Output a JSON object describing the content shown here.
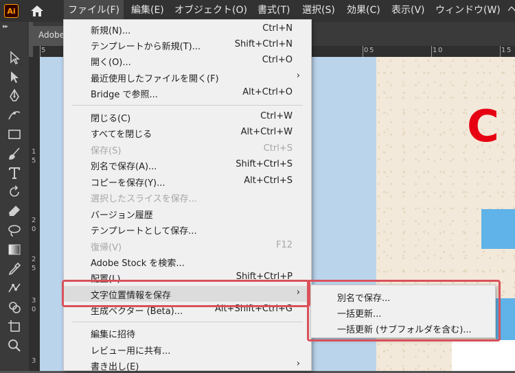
{
  "app": {
    "logo_text": "Ai",
    "document_tab": "Adobe"
  },
  "menubar": {
    "items": [
      {
        "label": "ファイル(F)"
      },
      {
        "label": "編集(E)"
      },
      {
        "label": "オブジェクト(O)"
      },
      {
        "label": "書式(T)"
      },
      {
        "label": "選択(S)"
      },
      {
        "label": "効果(C)"
      },
      {
        "label": "表示(V)"
      },
      {
        "label": "ウィンドウ(W)"
      }
    ],
    "overflow": "ヘ"
  },
  "rulers": {
    "top": [
      "5",
      "0",
      "5",
      "1",
      "0",
      "1",
      "5"
    ],
    "left": [
      "1",
      "5",
      "2",
      "0",
      "2",
      "5",
      "3",
      "0",
      "3"
    ]
  },
  "file_menu": {
    "items": [
      {
        "label": "新規(N)...",
        "shortcut": "Ctrl+N"
      },
      {
        "label": "テンプレートから新規(T)...",
        "shortcut": "Shift+Ctrl+N"
      },
      {
        "label": "開く(O)...",
        "shortcut": "Ctrl+O"
      },
      {
        "label": "最近使用したファイルを開く(F)",
        "shortcut": "",
        "submenu": true
      },
      {
        "label": "Bridge で参照...",
        "shortcut": "Alt+Ctrl+O"
      },
      {
        "label": "閉じる(C)",
        "shortcut": "Ctrl+W"
      },
      {
        "label": "すべてを閉じる",
        "shortcut": "Alt+Ctrl+W"
      },
      {
        "label": "保存(S)",
        "shortcut": "Ctrl+S",
        "disabled": true
      },
      {
        "label": "別名で保存(A)...",
        "shortcut": "Shift+Ctrl+S"
      },
      {
        "label": "コピーを保存(Y)...",
        "shortcut": "Alt+Ctrl+S"
      },
      {
        "label": "選択したスライスを保存...",
        "shortcut": "",
        "disabled": true
      },
      {
        "label": "バージョン履歴",
        "shortcut": ""
      },
      {
        "label": "テンプレートとして保存...",
        "shortcut": ""
      },
      {
        "label": "復帰(V)",
        "shortcut": "F12",
        "disabled": true
      },
      {
        "label": "Adobe Stock を検索...",
        "shortcut": ""
      },
      {
        "label": "配置(L)...",
        "shortcut": "Shift+Ctrl+P"
      },
      {
        "label": "文字位置情報を保存",
        "shortcut": "",
        "submenu": true,
        "highlighted": true
      },
      {
        "label": "生成ベクター (Beta)...",
        "shortcut": "Alt+Shift+Ctrl+G"
      },
      {
        "label": "編集に招待",
        "shortcut": ""
      },
      {
        "label": "レビュー用に共有...",
        "shortcut": ""
      },
      {
        "label": "書き出し(E)",
        "shortcut": "",
        "submenu": true
      }
    ],
    "submenu_arrow": "›"
  },
  "submenu": {
    "items": [
      {
        "label": "別名で保存..."
      },
      {
        "label": "一括更新..."
      },
      {
        "label": "一括更新 (サブフォルダを含む)..."
      }
    ]
  },
  "canvas": {
    "red_glyph": "C"
  },
  "colors": {
    "highlight_outline": "#d9515a",
    "accent_red": "#e60012",
    "artboard_blue": "#bad4ec"
  }
}
